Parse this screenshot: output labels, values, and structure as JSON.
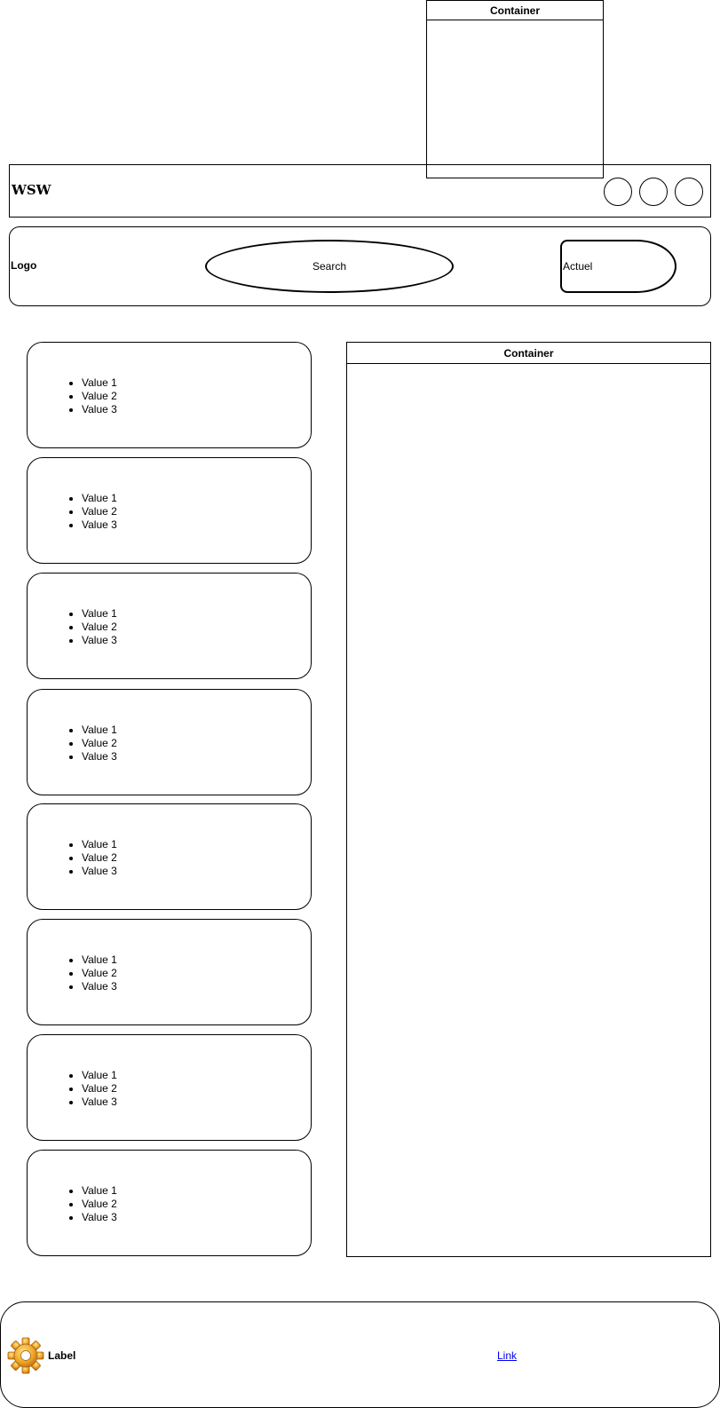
{
  "top_container": {
    "title": "Container"
  },
  "header": {
    "brand": "WSW",
    "circle_buttons": [
      {
        "name": "circle-1"
      },
      {
        "name": "circle-2"
      },
      {
        "name": "circle-3"
      }
    ]
  },
  "nav": {
    "logo": "Logo",
    "search_label": "Search",
    "actuel_label": "Actuel"
  },
  "cards": [
    {
      "items": [
        "Value 1",
        "Value 2",
        "Value 3"
      ]
    },
    {
      "items": [
        "Value 1",
        "Value 2",
        "Value 3"
      ]
    },
    {
      "items": [
        "Value 1",
        "Value 2",
        "Value 3"
      ]
    },
    {
      "items": [
        "Value 1",
        "Value 2",
        "Value 3"
      ]
    },
    {
      "items": [
        "Value 1",
        "Value 2",
        "Value 3"
      ]
    },
    {
      "items": [
        "Value 1",
        "Value 2",
        "Value 3"
      ]
    },
    {
      "items": [
        "Value 1",
        "Value 2",
        "Value 3"
      ]
    },
    {
      "items": [
        "Value 1",
        "Value 2",
        "Value 3"
      ]
    }
  ],
  "content_container": {
    "title": "Container"
  },
  "footer": {
    "icon": "gear-icon",
    "label": "Label",
    "link": "Link"
  },
  "colors": {
    "link": "#0000ee",
    "gear": "#e8a020"
  }
}
